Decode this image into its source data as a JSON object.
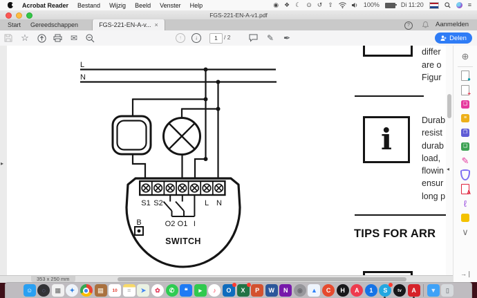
{
  "menubar": {
    "items": [
      "Acrobat Reader",
      "Bestand",
      "Wijzig",
      "Beeld",
      "Venster",
      "Help"
    ],
    "status": {
      "battery": "100%",
      "clock": "Di 11:20"
    }
  },
  "titlebar": {
    "title": "FGS-221-EN-A-v1.pdf"
  },
  "tabs": {
    "start": "Start",
    "tools": "Gereedschappen",
    "doc": "FGS-221-EN-A-v...",
    "close": "×"
  },
  "topbar": {
    "signin": "Aanmelden",
    "help": "?",
    "share": "Delen",
    "page_current": "1",
    "page_total": "/ 2",
    "nav_up": "↑",
    "nav_down": "↓",
    "star": "☆",
    "mail": "✉",
    "pen": "✎",
    "sign_pen": "✒"
  },
  "document": {
    "diagram": {
      "l_label": "L",
      "n_label": "N",
      "terminal_labels": {
        "s1": "S1",
        "s2": "S2",
        "l": "L",
        "n": "N"
      },
      "output_labels": {
        "o2": "O2",
        "o1": "O1",
        "i": "I"
      },
      "b_label": "B",
      "device_label": "SWITCH"
    },
    "right_column": {
      "fragments": [
        "differ",
        "are o",
        "Figur"
      ],
      "info_symbol": "i",
      "info_lines": [
        "Durab",
        "resist",
        "durab",
        "load,",
        "flowin",
        "ensur",
        "long p"
      ],
      "heading": "TIPS FOR ARR"
    },
    "size_indicator": "353 x 250 mm"
  },
  "tools_panel": {
    "accent_colors": {
      "export": "#0d9aa8",
      "create": "#e0233c",
      "edit": "#e5399e",
      "comment": "#edb01a",
      "combine": "#5f5cd6",
      "organize": "#3da254",
      "fill_sign": "#e5399e",
      "protect": "#7f6ff2",
      "standards": "#e0233c",
      "signature": "#9a4fe0",
      "more": "#f3c200"
    },
    "items": [
      {
        "name": "search-tools-icon",
        "kind": "glyph",
        "glyph": "⊕",
        "color": "#777"
      },
      {
        "type": "divider"
      },
      {
        "name": "export-pdf-icon",
        "kind": "page",
        "mark": "●",
        "color": "#0d9aa8"
      },
      {
        "name": "create-pdf-icon",
        "kind": "page",
        "mark": "+",
        "color": "#e0233c"
      },
      {
        "name": "edit-pdf-icon",
        "kind": "solid",
        "bg": "#e5399e",
        "glyph": "❑"
      },
      {
        "name": "comment-icon",
        "kind": "solid",
        "bg": "#edb01a",
        "glyph": "≡"
      },
      {
        "name": "combine-files-icon",
        "kind": "solid",
        "bg": "#5f5cd6",
        "glyph": "❐"
      },
      {
        "name": "organize-pages-icon",
        "kind": "solid",
        "bg": "#3da254",
        "glyph": "❏"
      },
      {
        "name": "fill-sign-icon",
        "kind": "glyph",
        "glyph": "✎",
        "color": "#e5399e"
      },
      {
        "name": "protect-icon",
        "kind": "shield"
      },
      {
        "name": "pdf-standards-icon",
        "kind": "page",
        "mark": "A",
        "color": "#e0233c",
        "border": "#e0233c"
      },
      {
        "name": "signature-icon",
        "kind": "glyph",
        "glyph": "ℓ",
        "color": "#9a4fe0"
      },
      {
        "name": "more-tools-icon",
        "kind": "solid",
        "bg": "#f3c200",
        "glyph": ""
      },
      {
        "name": "chevron-more-icon",
        "kind": "glyph",
        "glyph": "∨",
        "color": "#777"
      }
    ]
  },
  "dock": {
    "apps": [
      {
        "name": "finder",
        "shape": "round",
        "bg": "#2aa0f2",
        "glyph": "☺",
        "fg": "#ffffff"
      },
      {
        "name": "launchpad",
        "shape": "circle",
        "bg": "#323236",
        "glyph": "◌",
        "fg": "#9aa0ff"
      },
      {
        "name": "preview",
        "shape": "round",
        "bg": "#f1f1f1",
        "glyph": "▦",
        "fg": "#8b8b8b"
      },
      {
        "name": "safari",
        "shape": "circle",
        "bg": "#eef3f8",
        "glyph": "✦",
        "fg": "#2a7de1"
      },
      {
        "name": "chrome",
        "shape": "circle",
        "bg": "#ffffff",
        "glyph": "",
        "fg": "#4286f5",
        "cls": "chrome"
      },
      {
        "name": "contacts",
        "shape": "round",
        "bg": "#a9713f",
        "glyph": "▤",
        "fg": "#ecdcc6"
      },
      {
        "name": "calendar",
        "shape": "round",
        "bg": "#ffffff",
        "glyph": "10",
        "fg": "#e23b2e"
      },
      {
        "name": "notes",
        "shape": "round",
        "bg": "#ffffff",
        "glyph": "≡",
        "fg": "#b5b5b5",
        "cls": "notes"
      },
      {
        "name": "maps",
        "shape": "round",
        "bg": "#eaf2e3",
        "glyph": "➤",
        "fg": "#4285f4"
      },
      {
        "name": "photos",
        "shape": "circle",
        "bg": "#ffffff",
        "glyph": "✿",
        "fg": "#e4405f"
      },
      {
        "name": "whatsapp",
        "shape": "circle",
        "bg": "#2ecc51",
        "glyph": "✆",
        "fg": "#ffffff"
      },
      {
        "name": "messages",
        "shape": "round",
        "bg": "#1f7bf4",
        "glyph": "❝",
        "fg": "#ffffff"
      },
      {
        "name": "facetime",
        "shape": "round",
        "bg": "#30c94e",
        "glyph": "▸",
        "fg": "#ffffff"
      },
      {
        "name": "music",
        "shape": "circle",
        "bg": "#ffffff",
        "glyph": "♪",
        "fg": "#fa2d48"
      },
      {
        "name": "outlook",
        "shape": "round",
        "bg": "#0f6cbd",
        "glyph": "O",
        "fg": "#ffffff",
        "badge": true
      },
      {
        "name": "excel",
        "shape": "round",
        "bg": "#217346",
        "glyph": "X",
        "fg": "#ffffff",
        "badge": true
      },
      {
        "name": "powerpoint",
        "shape": "round",
        "bg": "#d35230",
        "glyph": "P",
        "fg": "#ffffff"
      },
      {
        "name": "word",
        "shape": "round",
        "bg": "#2b579a",
        "glyph": "W",
        "fg": "#ffffff"
      },
      {
        "name": "onenote",
        "shape": "round",
        "bg": "#7719aa",
        "glyph": "N",
        "fg": "#ffffff"
      },
      {
        "name": "system-preferences",
        "shape": "circle",
        "bg": "#97979c",
        "glyph": "◉",
        "fg": "#6f6f74"
      },
      {
        "name": "airdrop",
        "shape": "round",
        "bg": "#eef4fc",
        "glyph": "▲",
        "fg": "#2d7ff9"
      },
      {
        "name": "ccleaner",
        "shape": "circle",
        "bg": "#e64a2e",
        "glyph": "C",
        "fg": "#ffffff"
      },
      {
        "name": "handbrake",
        "shape": "circle",
        "bg": "#17171a",
        "glyph": "H",
        "fg": "#ffffff"
      },
      {
        "name": "adblock",
        "shape": "circle",
        "bg": "#ee3b4e",
        "glyph": "A",
        "fg": "#ffffff"
      },
      {
        "name": "onepassword",
        "shape": "circle",
        "bg": "#1573e6",
        "glyph": "1",
        "fg": "#ffffff"
      },
      {
        "name": "skype",
        "shape": "circle",
        "bg": "#23a7e0",
        "glyph": "S",
        "fg": "#ffffff",
        "badge": true,
        "dot": true
      },
      {
        "name": "apple-tv",
        "shape": "circle",
        "bg": "#17171a",
        "glyph": "tv",
        "fg": "#ffffff"
      },
      {
        "name": "acrobat-reader",
        "shape": "round",
        "bg": "#d6222a",
        "glyph": "A",
        "fg": "#ffffff",
        "dot": true
      },
      {
        "type": "divider"
      },
      {
        "name": "downloads-folder",
        "shape": "round",
        "bg": "#3fa2f7",
        "glyph": "▼",
        "fg": "#dceafc"
      },
      {
        "name": "trash",
        "shape": "round",
        "bg": "#d7dadd",
        "glyph": "▯",
        "fg": "#8a8f94"
      }
    ]
  }
}
